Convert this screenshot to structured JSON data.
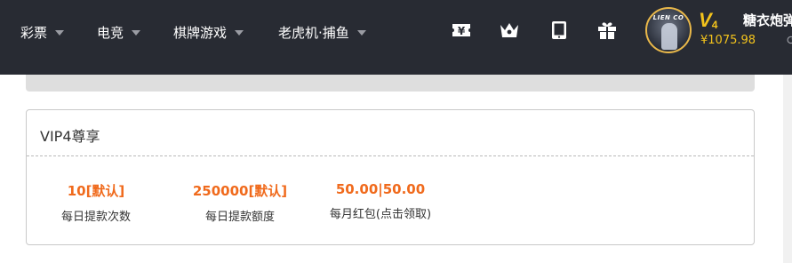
{
  "nav": {
    "items": [
      {
        "label": "彩票"
      },
      {
        "label": "电竞"
      },
      {
        "label": "棋牌游戏"
      },
      {
        "label": "老虎机·捕鱼"
      }
    ]
  },
  "header_icons": [
    "yen-ticket-icon",
    "crown-icon",
    "tablet-icon",
    "gift-icon"
  ],
  "user": {
    "avatar_text": "LIEN CO",
    "vip_level": "V",
    "vip_number": "4",
    "username": "糖衣炮弹",
    "balance": "¥1075.98"
  },
  "vip_card": {
    "title": "VIP4尊享",
    "stats": [
      {
        "value": "10[默认]",
        "label": "每日提款次数"
      },
      {
        "value": "250000[默认]",
        "label": "每日提款额度"
      },
      {
        "value": "50.00|50.00",
        "label": "每月红包(点击领取)"
      }
    ]
  },
  "colors": {
    "header_bg": "#282b33",
    "accent_gold": "#f3c31c",
    "accent_orange": "#f06a1c"
  }
}
